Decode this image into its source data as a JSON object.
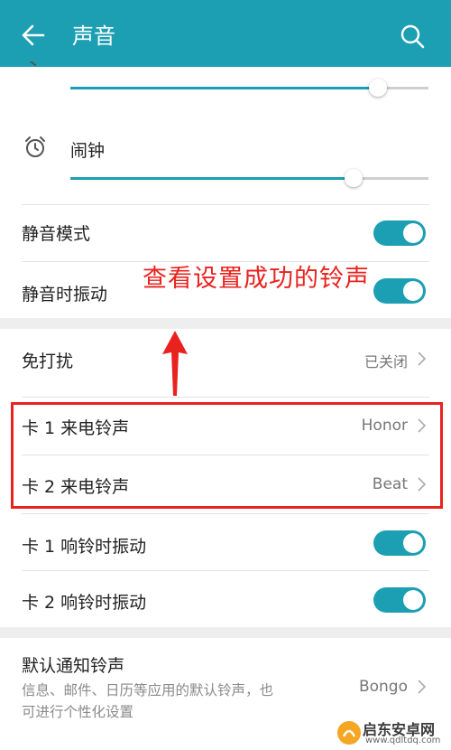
{
  "header": {
    "title": "声音"
  },
  "volume": {
    "top_slider_level": 0.86,
    "alarm_label": "闹钟",
    "alarm_level": 0.79
  },
  "settings": {
    "silent_mode": {
      "label": "静音模式",
      "on": true
    },
    "silent_vibrate": {
      "label": "静音时振动",
      "on": true
    },
    "dnd": {
      "label": "免打扰",
      "value": "已关闭"
    },
    "sim1_ringtone": {
      "label": "卡 1 来电铃声",
      "value": "Honor"
    },
    "sim2_ringtone": {
      "label": "卡 2 来电铃声",
      "value": "Beat"
    },
    "sim1_vibrate": {
      "label": "卡 1 响铃时振动",
      "on": true
    },
    "sim2_vibrate": {
      "label": "卡 2 响铃时振动",
      "on": true
    },
    "notification": {
      "label": "默认通知铃声",
      "description": "信息、邮件、日历等应用的默认铃声，也可进行个性化设置",
      "value": "Bongo"
    }
  },
  "annotation": {
    "text": "查看设置成功的铃声"
  },
  "watermark": {
    "text": "启东安卓网",
    "url": "www.qdltdq.com"
  },
  "colors": {
    "accent": "#1c9fb3",
    "annotation": "#e8231f"
  }
}
